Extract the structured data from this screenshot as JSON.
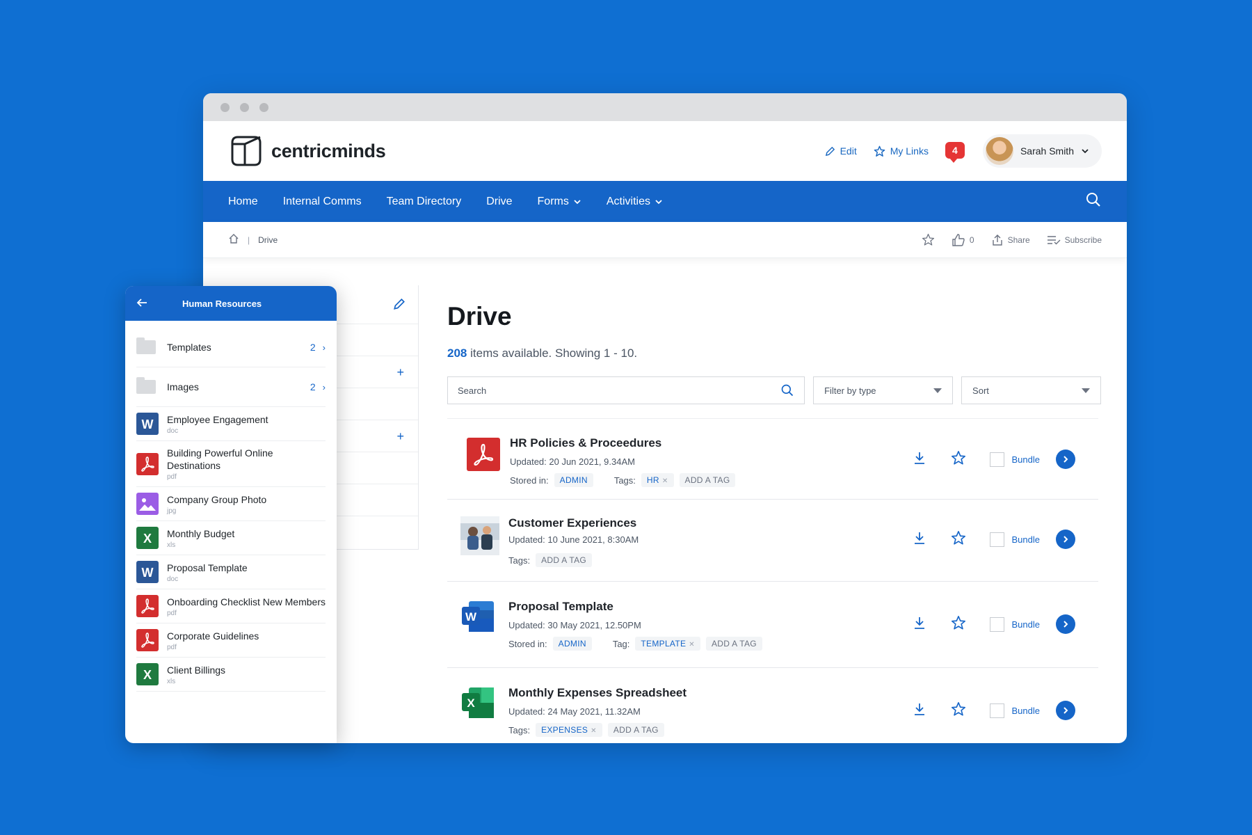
{
  "app": {
    "brand": "centricminds",
    "colors": {
      "background": "#0f6fd2",
      "primary": "#1565c8",
      "danger": "#e53535"
    }
  },
  "header": {
    "edit_label": "Edit",
    "mylinks_label": "My Links",
    "notification_count": "4",
    "user_name": "Sarah Smith"
  },
  "nav": {
    "items": [
      "Home",
      "Internal Comms",
      "Team Directory",
      "Drive",
      "Forms",
      "Activities"
    ]
  },
  "breadcrumb": {
    "current": "Drive",
    "likes": "0",
    "share_label": "Share",
    "subscribe_label": "Subscribe"
  },
  "main": {
    "title": "Drive",
    "count_number": "208",
    "count_text": "items available. Showing 1 - 10.",
    "search_placeholder": "Search",
    "filter_placeholder": "Filter by type",
    "sort_placeholder": "Sort",
    "bundle_label": "Bundle",
    "files": [
      {
        "title": "HR Policies & Proceedures",
        "updated": "Updated: 20 Jun 2021, 9.34AM",
        "icon": "pdf-icon",
        "stored_label": "Stored in:",
        "stored": "ADMIN",
        "tags_label": "Tags:",
        "tags": [
          "HR"
        ],
        "add_tag": "ADD A TAG"
      },
      {
        "title": "Customer Experiences",
        "updated": "Updated: 10 June 2021, 8:30AM",
        "icon": "photo-thumbnail",
        "tags_label": "Tags:",
        "add_tag": "ADD A TAG"
      },
      {
        "title": "Proposal Template",
        "updated": "Updated: 30 May 2021, 12.50PM",
        "icon": "word-icon",
        "stored_label": "Stored in:",
        "stored": "ADMIN",
        "tags_label": "Tag:",
        "tags": [
          "TEMPLATE"
        ],
        "add_tag": "ADD A TAG"
      },
      {
        "title": "Monthly Expenses Spreadsheet",
        "updated": "Updated: 24 May 2021, 11.32AM",
        "icon": "excel-icon",
        "tags_label": "Tags:",
        "tags": [
          "EXPENSES"
        ],
        "add_tag": "ADD A TAG"
      }
    ]
  },
  "sidebar": {
    "title": "Human Resources",
    "folders": [
      {
        "name": "Templates",
        "count": "2"
      },
      {
        "name": "Images",
        "count": "2"
      }
    ],
    "files": [
      {
        "name": "Employee Engagement",
        "ext": "doc",
        "icon": "word-icon"
      },
      {
        "name": "Building Powerful Online Destinations",
        "ext": "pdf",
        "icon": "pdf-icon"
      },
      {
        "name": "Company Group Photo",
        "ext": "jpg",
        "icon": "image-icon"
      },
      {
        "name": "Monthly Budget",
        "ext": "xls",
        "icon": "excel-icon"
      },
      {
        "name": "Proposal Template",
        "ext": "doc",
        "icon": "word-icon"
      },
      {
        "name": "Onboarding Checklist New Members",
        "ext": "pdf",
        "icon": "pdf-icon"
      },
      {
        "name": "Corporate Guidelines",
        "ext": "pdf",
        "icon": "pdf-icon"
      },
      {
        "name": "Client Billings",
        "ext": "xls",
        "icon": "excel-icon"
      }
    ]
  }
}
